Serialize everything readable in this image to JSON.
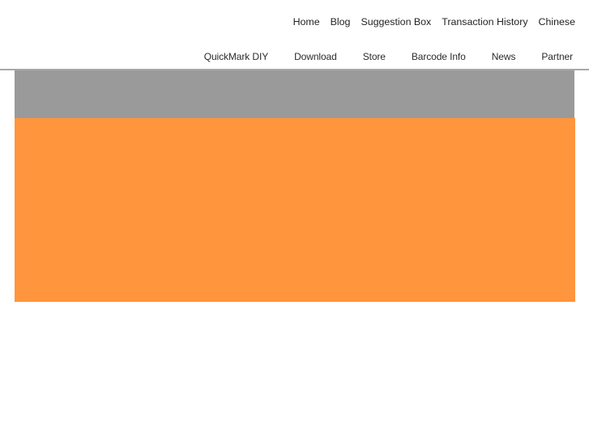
{
  "top_nav": {
    "items": [
      {
        "label": "Home",
        "name": "nav-home"
      },
      {
        "label": "Blog",
        "name": "nav-blog"
      },
      {
        "label": "Suggestion Box",
        "name": "nav-suggestion-box"
      },
      {
        "label": "Transaction History",
        "name": "nav-transaction-history"
      },
      {
        "label": "Chinese",
        "name": "nav-chinese"
      }
    ]
  },
  "main_nav": {
    "items": [
      {
        "label": "QuickMark DIY",
        "name": "nav-quickmark-diy"
      },
      {
        "label": "Download",
        "name": "nav-download"
      },
      {
        "label": "Store",
        "name": "nav-store"
      },
      {
        "label": "Barcode Info",
        "name": "nav-barcode-info"
      },
      {
        "label": "News",
        "name": "nav-news"
      },
      {
        "label": "Partner",
        "name": "nav-partner"
      }
    ]
  },
  "content": {
    "banner_top_color": "#9a9a9a",
    "banner_main_color": "#ff953d"
  }
}
